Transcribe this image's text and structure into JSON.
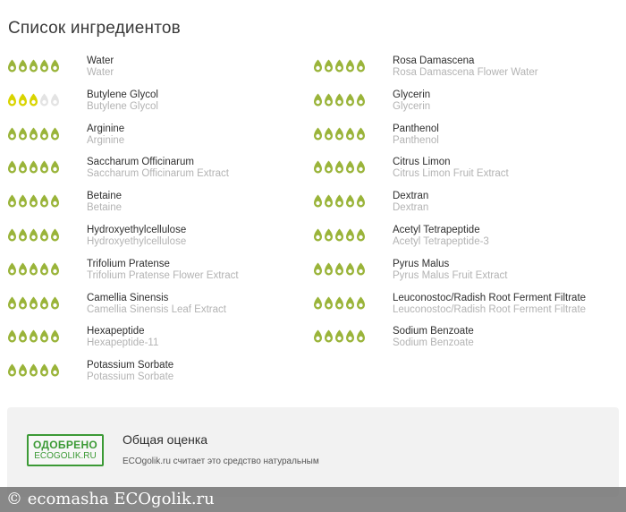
{
  "title": "Список ингредиентов",
  "colors": {
    "green": "#9ab43a",
    "yellow": "#d9d400",
    "empty": "#e3e3e3",
    "stamp": "#3c9a36"
  },
  "left_column": [
    {
      "name": "Water",
      "sub": "Water",
      "rating": 5,
      "rating_color": "green"
    },
    {
      "name": "Butylene Glycol",
      "sub": "Butylene Glycol",
      "rating": 3,
      "rating_color": "yellow"
    },
    {
      "name": "Arginine",
      "sub": "Arginine",
      "rating": 5,
      "rating_color": "green"
    },
    {
      "name": "Saccharum Officinarum",
      "sub": "Saccharum Officinarum Extract",
      "rating": 5,
      "rating_color": "green"
    },
    {
      "name": "Betaine",
      "sub": "Betaine",
      "rating": 5,
      "rating_color": "green"
    },
    {
      "name": "Hydroxyethylcellulose",
      "sub": "Hydroxyethylcellulose",
      "rating": 5,
      "rating_color": "green"
    },
    {
      "name": "Trifolium Pratense",
      "sub": "Trifolium Pratense Flower Extract",
      "rating": 5,
      "rating_color": "green"
    },
    {
      "name": "Camellia Sinensis",
      "sub": "Camellia Sinensis Leaf Extract",
      "rating": 5,
      "rating_color": "green"
    },
    {
      "name": "Hexapeptide",
      "sub": "Hexapeptide-11",
      "rating": 5,
      "rating_color": "green"
    },
    {
      "name": "Potassium Sorbate",
      "sub": "Potassium Sorbate",
      "rating": 5,
      "rating_color": "green"
    }
  ],
  "right_column": [
    {
      "name": "Rosa Damascena",
      "sub": "Rosa Damascena Flower Water",
      "rating": 5,
      "rating_color": "green"
    },
    {
      "name": "Glycerin",
      "sub": "Glycerin",
      "rating": 5,
      "rating_color": "green"
    },
    {
      "name": "Panthenol",
      "sub": "Panthenol",
      "rating": 5,
      "rating_color": "green"
    },
    {
      "name": "Citrus Limon",
      "sub": "Citrus Limon Fruit Extract",
      "rating": 5,
      "rating_color": "green"
    },
    {
      "name": "Dextran",
      "sub": "Dextran",
      "rating": 5,
      "rating_color": "green"
    },
    {
      "name": "Acetyl Tetrapeptide",
      "sub": "Acetyl Tetrapeptide-3",
      "rating": 5,
      "rating_color": "green"
    },
    {
      "name": "Pyrus Malus",
      "sub": "Pyrus Malus Fruit Extract",
      "rating": 5,
      "rating_color": "green"
    },
    {
      "name": "Leuconostoc/Radish Root Ferment Filtrate",
      "sub": "Leuconostoc/Radish Root Ferment Filtrate",
      "rating": 5,
      "rating_color": "green"
    },
    {
      "name": "Sodium Benzoate",
      "sub": "Sodium Benzoate",
      "rating": 5,
      "rating_color": "green"
    }
  ],
  "verdict": {
    "stamp_line1": "ОДОБРЕНО",
    "stamp_line2": "ECOGOLIK.RU",
    "title": "Общая оценка",
    "description": "ECOgolik.ru считает это средство натуральным"
  },
  "watermark": "© ecomasha  ECOgolik.ru"
}
